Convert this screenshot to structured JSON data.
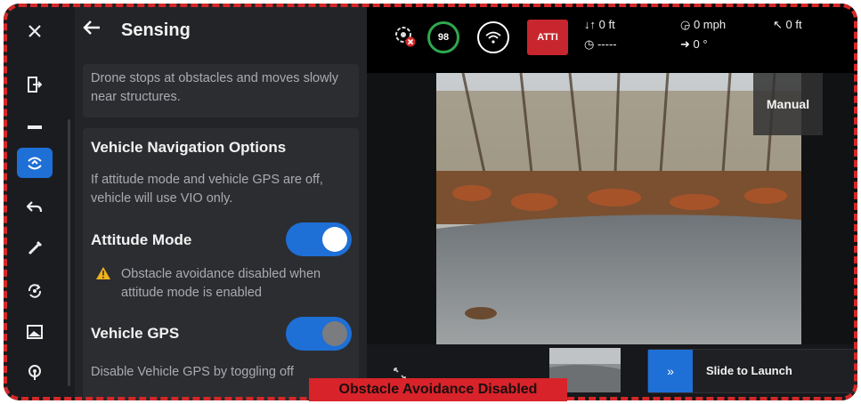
{
  "rail": {
    "close_icon": "close-icon",
    "items": [
      {
        "name": "logout-icon",
        "active": false
      },
      {
        "name": "dash-icon",
        "active": false
      },
      {
        "name": "sensing-icon",
        "active": true
      },
      {
        "name": "return-icon",
        "active": false
      },
      {
        "name": "pen-icon",
        "active": false
      },
      {
        "name": "camera-rotate-icon",
        "active": false
      },
      {
        "name": "image-icon",
        "active": false
      },
      {
        "name": "antenna-icon",
        "active": false
      }
    ]
  },
  "panel": {
    "title": "Sensing",
    "intro_text": "Drone stops at obstacles and moves slowly near structures.",
    "nav_title": "Vehicle Navigation Options",
    "nav_desc": "If attitude mode and vehicle GPS are off, vehicle will use VIO only.",
    "attitude_label": "Attitude Mode",
    "attitude_on": true,
    "warning_text": "Obstacle avoidance disabled when attitude mode is enabled",
    "gps_label": "Vehicle GPS",
    "gps_on": true,
    "gps_desc": "Disable Vehicle GPS by toggling off"
  },
  "status": {
    "battery": "98",
    "mode": "ATTI",
    "altitude": "0 ft",
    "timer": "-----",
    "speed": "0 mph",
    "heading": "0 °",
    "distance": "0 ft"
  },
  "camera": {
    "mode_label": "Manual"
  },
  "launch": {
    "label": "Slide to Launch",
    "button_glyph": "»"
  },
  "alert": {
    "text": "Obstacle Avoidance Disabled"
  },
  "colors": {
    "accent": "#1e6fd6",
    "alert": "#d8232a",
    "warning": "#f0b21b",
    "battery_ring": "#2fa84f"
  }
}
